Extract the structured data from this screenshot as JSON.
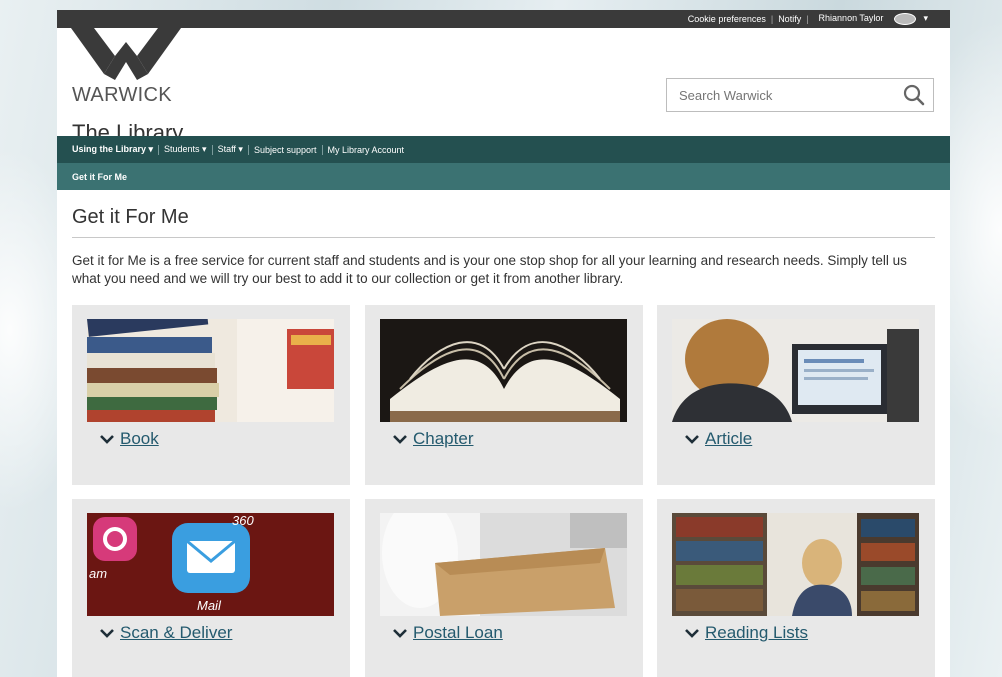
{
  "utility": {
    "cookie": "Cookie preferences",
    "notify": "Notify",
    "user": "Rhiannon Taylor"
  },
  "header": {
    "logo_text": "WARWICK",
    "site_title": "The Library",
    "search_placeholder": "Search Warwick"
  },
  "nav": {
    "primary": [
      "Using the Library ▾",
      "Students ▾",
      "Staff ▾",
      "Subject support",
      "My Library Account"
    ],
    "secondary": "Get it For Me"
  },
  "main": {
    "heading": "Get it For Me",
    "intro": "Get it for Me is a free service for current staff and students and is your one stop shop for all your learning and research needs. Simply tell us what you need and we will try our best to add it to our collection or get it from another library."
  },
  "cards": [
    {
      "label": "Book"
    },
    {
      "label": "Chapter"
    },
    {
      "label": "Article"
    },
    {
      "label": "Scan & Deliver"
    },
    {
      "label": "Postal Loan"
    },
    {
      "label": "Reading Lists"
    }
  ],
  "colors": {
    "nav_primary": "#245050",
    "nav_secondary": "#3b7272",
    "link": "#245a6e",
    "card_bg": "#e8e8e8"
  }
}
